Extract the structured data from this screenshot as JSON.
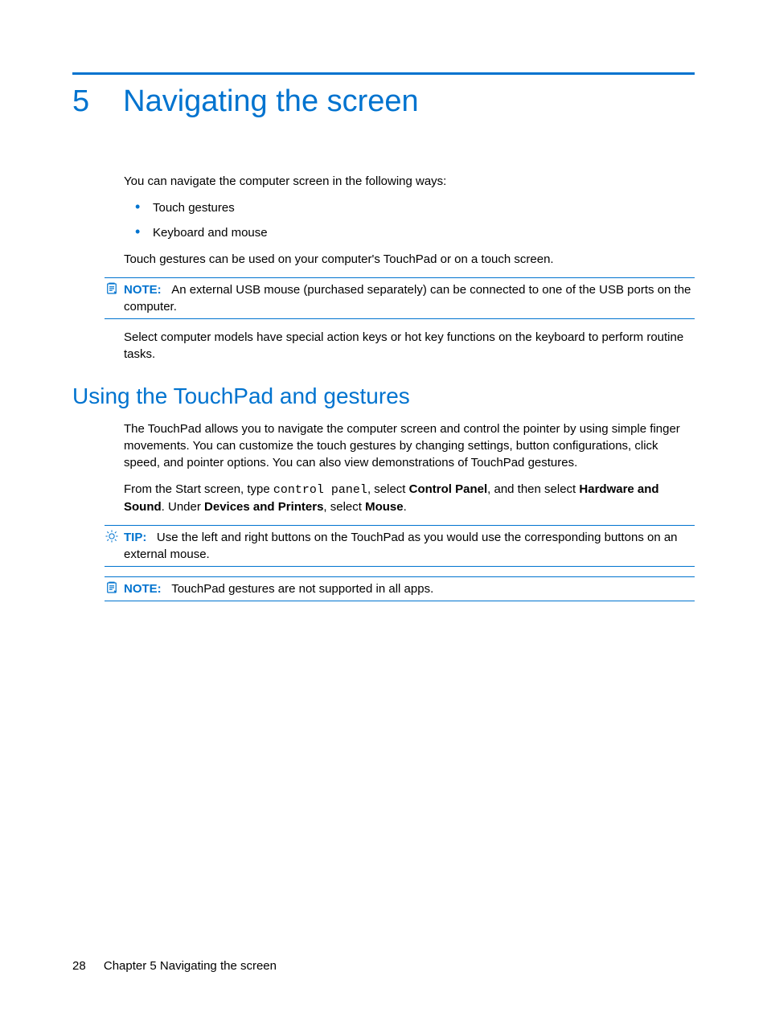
{
  "chapter": {
    "number": "5",
    "title": "Navigating the screen"
  },
  "intro": {
    "lead": "You can navigate the computer screen in the following ways:",
    "bullets": [
      "Touch gestures",
      "Keyboard and mouse"
    ],
    "after_bullets": "Touch gestures can be used on your computer's TouchPad or on a touch screen."
  },
  "note1": {
    "label": "NOTE:",
    "text": "An external USB mouse (purchased separately) can be connected to one of the USB ports on the computer."
  },
  "action_keys_para": "Select computer models have special action keys or hot key functions on the keyboard to perform routine tasks.",
  "section": {
    "heading": "Using the TouchPad and gestures",
    "para1": "The TouchPad allows you to navigate the computer screen and control the pointer by using simple finger movements. You can customize the touch gestures by changing settings, button configurations, click speed, and pointer options. You can also view demonstrations of TouchPad gestures.",
    "para2_pre": "From the Start screen, type ",
    "para2_code": "control panel",
    "para2_mid1": ", select ",
    "para2_b1": "Control Panel",
    "para2_mid2": ", and then select ",
    "para2_b2": "Hardware and Sound",
    "para2_mid3": ". Under ",
    "para2_b3": "Devices and Printers",
    "para2_mid4": ", select ",
    "para2_b4": "Mouse",
    "para2_end": "."
  },
  "tip": {
    "label": "TIP:",
    "text": "Use the left and right buttons on the TouchPad as you would use the corresponding buttons on an external mouse."
  },
  "note2": {
    "label": "NOTE:",
    "text": "TouchPad gestures are not supported in all apps."
  },
  "footer": {
    "page": "28",
    "chapter_label": "Chapter 5   Navigating the screen"
  }
}
